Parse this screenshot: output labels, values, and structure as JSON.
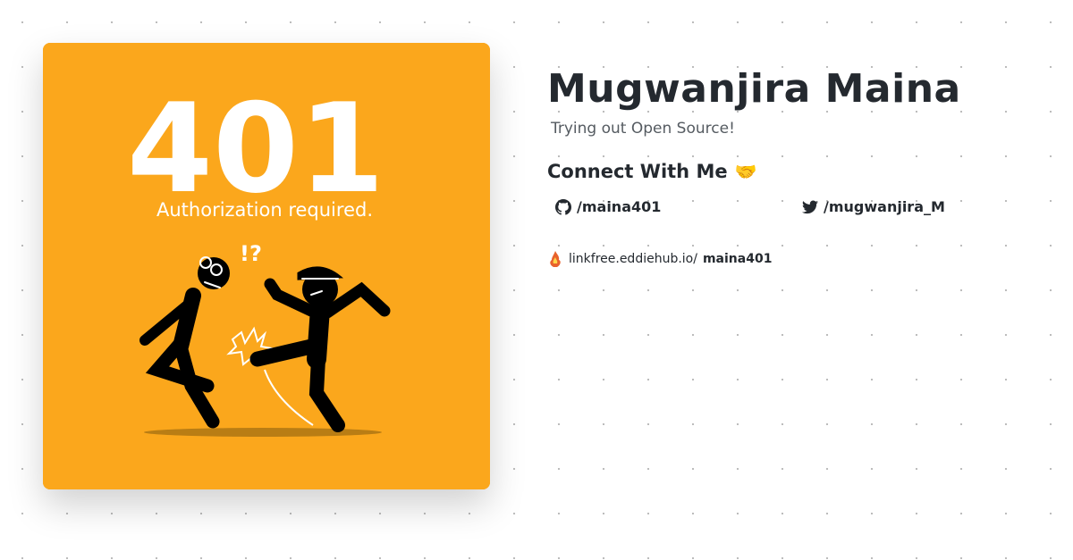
{
  "avatar": {
    "code": "401",
    "caption": "Authorization required.",
    "exclaim": "!?",
    "background": "#fba71c"
  },
  "profile": {
    "name": "Mugwanjira Maina",
    "bio": "Trying out Open Source!"
  },
  "connect": {
    "heading": "Connect With Me",
    "emoji": "🤝"
  },
  "socials": [
    {
      "platform": "github",
      "icon": "github-icon",
      "handle": "/maina401"
    },
    {
      "platform": "twitter",
      "icon": "twitter-icon",
      "handle": "/mugwanjira_M"
    }
  ],
  "linkfree": {
    "icon": "flame-logo-icon",
    "prefix": "linkfree.eddiehub.io/",
    "username": "maina401"
  }
}
